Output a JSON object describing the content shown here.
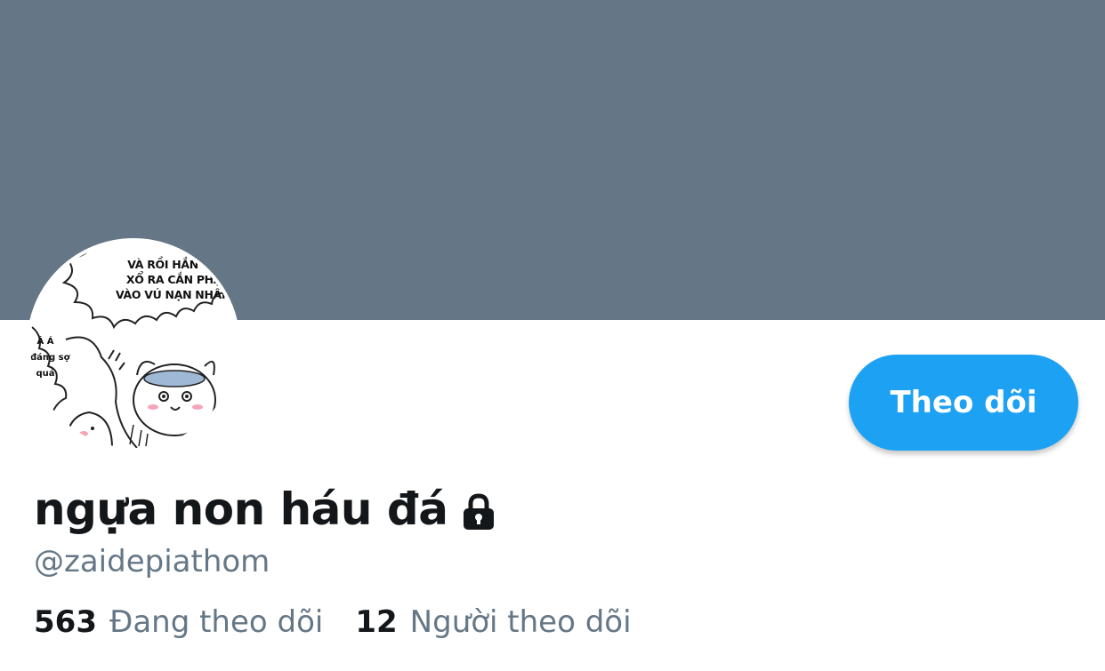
{
  "banner": {
    "color": "#657786"
  },
  "avatar": {
    "caption_lines": [
      "VÀ RỒI HẮN NHẢ",
      "XỔ RA CẮN PHẬP",
      "VÀO VÚ NẠN NHÂN!!"
    ],
    "side_lines": [
      "Á Á",
      "đáng sợ",
      "quá"
    ]
  },
  "follow_button": {
    "label": "Theo dõi",
    "color": "#1da1f2"
  },
  "profile": {
    "display_name": "ngựa non háu đá",
    "handle": "@zaidepiathom",
    "lock_icon": "lock-icon"
  },
  "stats": {
    "following": {
      "count": "563",
      "label": "Đang theo dõi"
    },
    "followers": {
      "count": "12",
      "label": "Người theo dõi"
    }
  }
}
